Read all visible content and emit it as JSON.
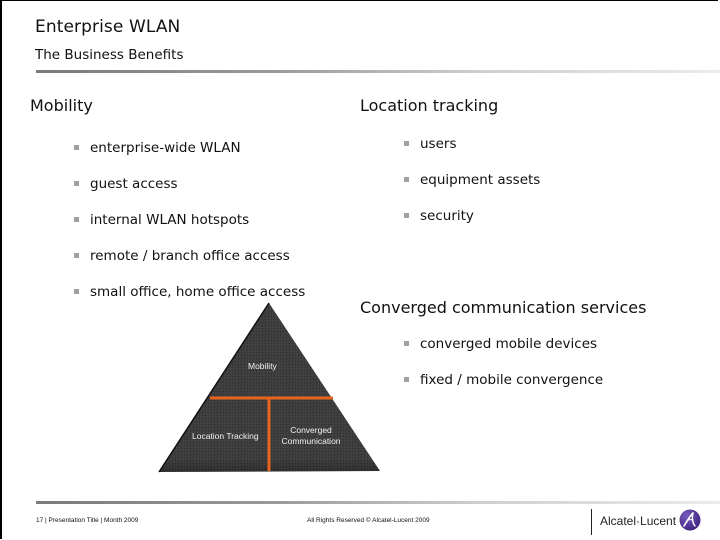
{
  "header": {
    "title": "Enterprise WLAN",
    "subtitle": "The Business Benefits"
  },
  "sections": {
    "mobility": {
      "heading": "Mobility",
      "items": [
        "enterprise-wide WLAN",
        "guest access",
        "internal WLAN hotspots",
        "remote / branch office access",
        "small office, home office access"
      ]
    },
    "location_tracking": {
      "heading": "Location tracking",
      "items": [
        "users",
        "equipment assets",
        "security"
      ]
    },
    "converged": {
      "heading": "Converged communication services",
      "items": [
        "converged mobile devices",
        "fixed / mobile convergence"
      ]
    }
  },
  "pyramid": {
    "top_label": "Mobility",
    "bottom_left_label": "Location Tracking",
    "bottom_right_label_line1": "Converged",
    "bottom_right_label_line2": "Communication",
    "fill_color": "#3d3d3d",
    "divider_color": "#e8641c"
  },
  "footer": {
    "left_text": "17 | Presentation Title | Month 2009",
    "center_text": "All Rights Reserved © Alcatel-Lucent 2009",
    "logo_text": "Alcatel·Lucent",
    "logo_icon": "alcatel-lucent-logo-icon",
    "logo_color": "#4a2a8a"
  }
}
